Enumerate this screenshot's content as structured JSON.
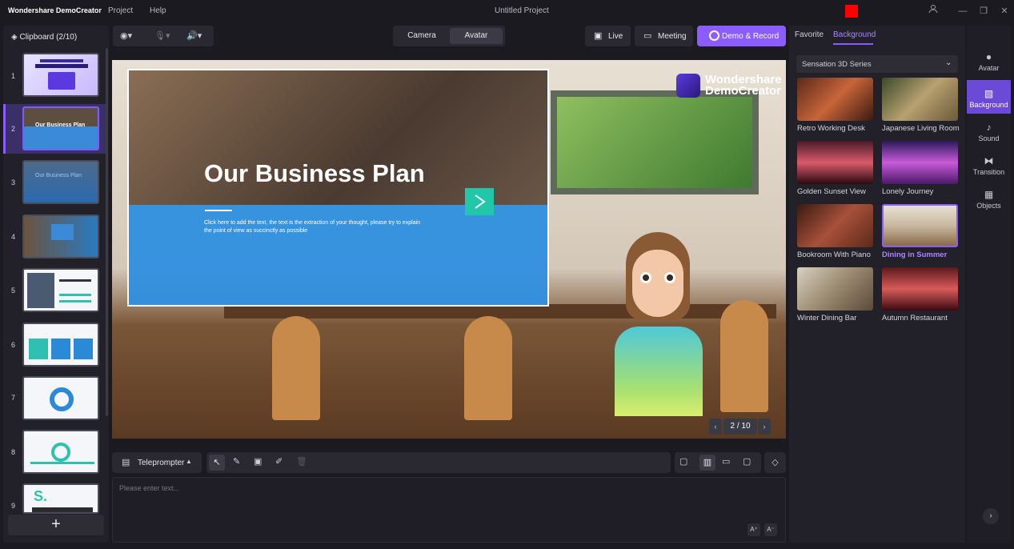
{
  "titlebar": {
    "app": "Wondershare DemoCreator",
    "menu": [
      "Project",
      "Help"
    ],
    "project": "Untitled Project"
  },
  "clipboard": {
    "title": "Clipboard (2/10)",
    "slides": [
      "1",
      "2",
      "3",
      "4",
      "5",
      "6",
      "7",
      "8",
      "9"
    ],
    "add": "+"
  },
  "toolbar": {
    "camera": "Camera",
    "avatar": "Avatar",
    "live": "Live",
    "meeting": "Meeting",
    "record": "Demo & Record"
  },
  "stage": {
    "title": "Our Business Plan",
    "body": "Click here to add the text, the text is the extraction of your thought, please try to explain the point of view as succinctly as possible",
    "logo1": "Wondershare",
    "logo2": "DemoCreator",
    "page": "2 / 10"
  },
  "teleprompter": {
    "label": "Teleprompter",
    "placeholder": "Please enter text..."
  },
  "right": {
    "tabs": [
      "Favorite",
      "Background"
    ],
    "series": "Sensation 3D Series",
    "backgrounds": [
      "Retro Working Desk",
      "Japanese Living Room",
      "Golden Sunset View",
      "Lonely Journey",
      "Bookroom With Piano",
      "Dining in Summer",
      "Winter Dining Bar",
      "Autumn Restaurant"
    ],
    "selected": "Dining in Summer"
  },
  "sidebar": {
    "items": [
      "Avatar",
      "Background",
      "Sound",
      "Transition",
      "Objects"
    ]
  },
  "colors": {
    "accent": "#8b5cff",
    "bg": "#1b1a21",
    "teal": "#22c7a9",
    "blue": "#2f8fe0"
  }
}
